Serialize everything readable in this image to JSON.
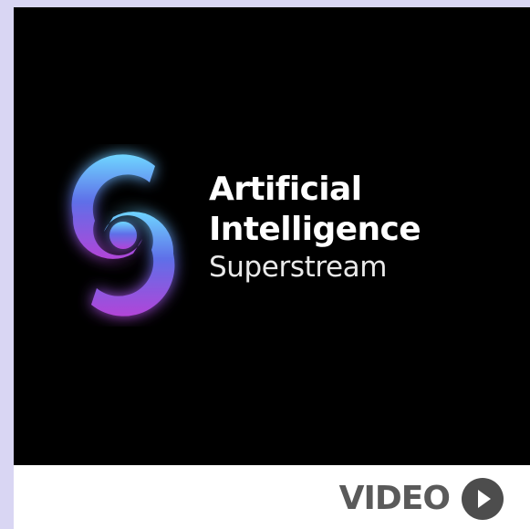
{
  "hero": {
    "title_line1": "Artificial",
    "title_line2": "Intelligence",
    "title_line3": "Superstream"
  },
  "footer": {
    "video_label": "VIDEO",
    "play_icon": "play-circle-icon"
  },
  "colors": {
    "page_background": "#d9d6f3",
    "hero_background": "#000000",
    "logo_gradient_top": "#6fd6ff",
    "logo_gradient_mid": "#5f6fe8",
    "logo_gradient_bottom": "#b245d8",
    "video_label": "#5a5a5a",
    "play_button": "#4d4d4d"
  }
}
